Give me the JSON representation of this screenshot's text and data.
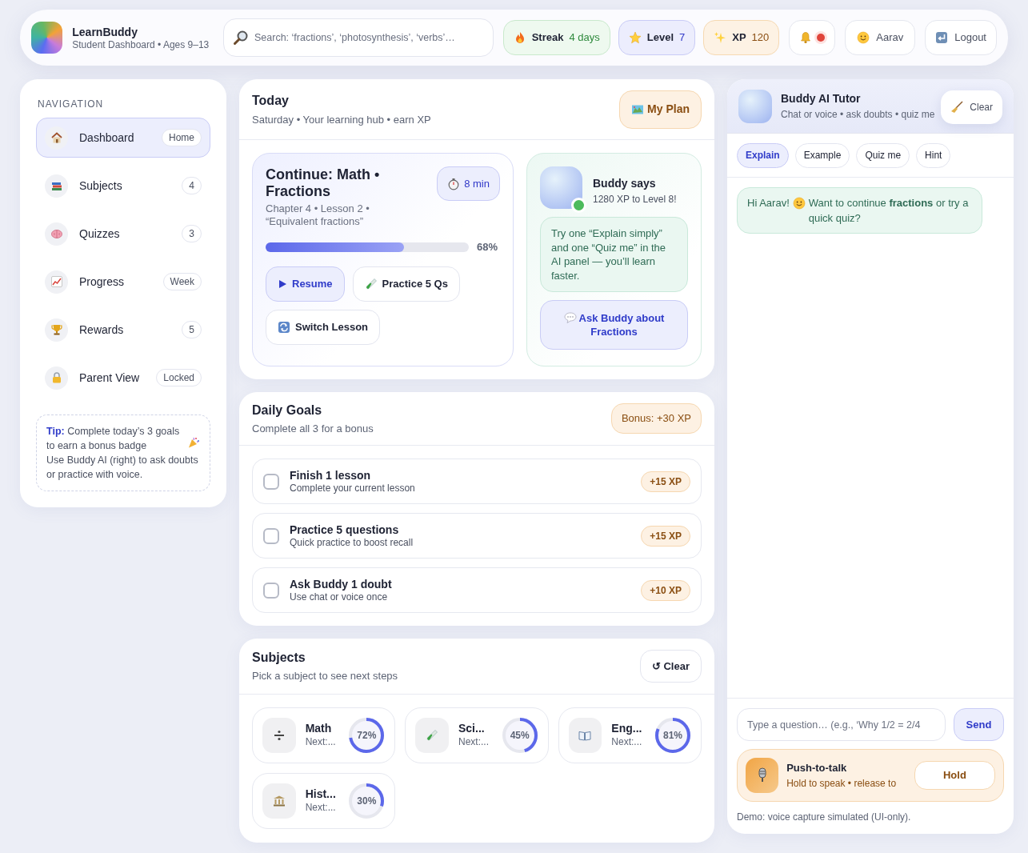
{
  "header": {
    "app_name": "LearnBuddy",
    "subtitle": "Student Dashboard • Ages 9–13",
    "search": {
      "placeholder": "Search: ‘fractions’, ‘photosynthesis’, ‘verbs’…"
    },
    "stats": [
      {
        "kind": "streak",
        "label": "Streak",
        "value": "4 days"
      },
      {
        "kind": "level",
        "label": "Level",
        "value": "7"
      },
      {
        "kind": "xp",
        "label": "XP",
        "value": "120"
      }
    ],
    "notifications": {
      "unread": true
    },
    "user": "Aarav",
    "logout": "Logout"
  },
  "sidebar": {
    "heading": "NAVIGATION",
    "items": [
      {
        "label": "Dashboard",
        "badge": "Home",
        "selected": true
      },
      {
        "label": "Subjects",
        "badge": "4",
        "selected": false
      },
      {
        "label": "Quizzes",
        "badge": "3",
        "selected": false
      },
      {
        "label": "Progress",
        "badge": "Week",
        "selected": false
      },
      {
        "label": "Rewards",
        "badge": "5",
        "selected": false
      },
      {
        "label": "Parent View",
        "badge": "Locked",
        "selected": false
      }
    ],
    "tip": {
      "before": "**Tip:** Complete today’s 3 goals to earn a bonus badge",
      "after": "Use Buddy AI (right) to ask doubts or practice with voice."
    }
  },
  "today": {
    "title": "Today",
    "subtitle": "Saturday • Your learning hub • earn XP",
    "plan_button": "My Plan",
    "continue": {
      "title": "Continue: Math • Fractions",
      "time": "8 min",
      "details": "Chapter 4 • Lesson 2 • “Equivalent fractions”",
      "level": 0.68,
      "percent": "68%",
      "buttons": [
        {
          "kind": "primary",
          "label": "Resume"
        },
        {
          "kind": "plain",
          "label": "Practice 5 Qs"
        },
        {
          "kind": "plain",
          "label": "Switch Lesson"
        }
      ]
    },
    "buddy": {
      "title": "Buddy says",
      "subtitle": "1280 XP to Level 8!",
      "online": true,
      "tip": "Try one “Explain simply” and one “Quiz me” in the AI panel — you’ll learn faster.",
      "ask_button": "Ask Buddy about Fractions"
    }
  },
  "daily_goals": {
    "title": "Daily Goals",
    "subtitle": "Complete all 3 for a bonus",
    "bonus": "Bonus: +30 XP",
    "goals": [
      {
        "title": "Finish 1 lesson",
        "subtitle": "Complete your current lesson",
        "xp": "+15 XP",
        "checked": false
      },
      {
        "title": "Practice 5 questions",
        "subtitle": "Quick practice to boost recall",
        "xp": "+15 XP",
        "checked": false
      },
      {
        "title": "Ask Buddy 1 doubt",
        "subtitle": "Use chat or voice once",
        "xp": "+10 XP",
        "checked": false
      }
    ]
  },
  "subjects": {
    "title": "Subjects",
    "subtitle": "Pick a subject to see next steps",
    "clear_button": "↺ Clear",
    "items": [
      {
        "name": "Math",
        "next": "Next:...",
        "percent": "72%",
        "level": 0.72
      },
      {
        "name": "Sci...",
        "next": "Next:...",
        "percent": "45%",
        "level": 0.45
      },
      {
        "name": "Eng...",
        "next": "Next:...",
        "percent": "81%",
        "level": 0.81
      },
      {
        "name": "Hist...",
        "next": "Next:...",
        "percent": "30%",
        "level": 0.3
      }
    ]
  },
  "tutor": {
    "title": "Buddy AI Tutor",
    "subtitle": "Chat or voice • ask doubts • quiz me",
    "clear_button": "Clear",
    "modes": [
      {
        "label": "Explain",
        "selected": true
      },
      {
        "label": "Example",
        "selected": false
      },
      {
        "label": "Quiz me",
        "selected": false
      },
      {
        "label": "Hint",
        "selected": false
      }
    ],
    "messages": [
      {
        "before": "Hi Aarav!",
        "after": "Want to continue **fractions** or try a quick quiz?"
      }
    ],
    "input": {
      "placeholder": "Type a question… (e.g., ‘Why 1/2 = 2/4"
    },
    "send_button": "Send",
    "push_to_talk": {
      "title": "Push-to-talk",
      "subtitle": "Hold to speak • release to",
      "button": "Hold"
    },
    "note": "Demo: voice capture simulated (UI-only)."
  }
}
